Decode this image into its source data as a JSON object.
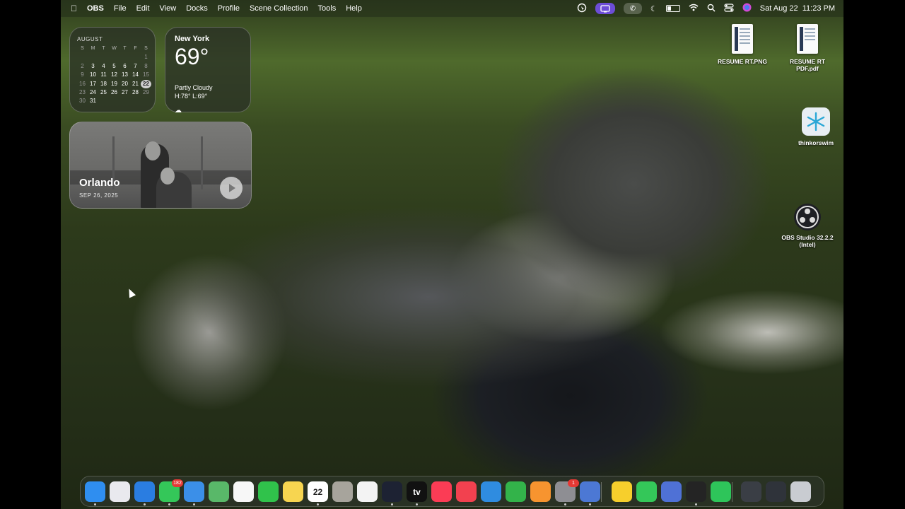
{
  "menubar": {
    "app_name": "OBS",
    "menus": [
      "File",
      "Edit",
      "View",
      "Docks",
      "Profile",
      "Scene Collection",
      "Tools",
      "Help"
    ],
    "status_icons": [
      "cursor-circle-icon",
      "screen-record-icon",
      "phone-icon",
      "moon-icon",
      "battery-icon",
      "wifi-icon",
      "search-icon",
      "control-center-icon",
      "siri-icon"
    ],
    "datetime": "Sat Aug 22  11:23 PM"
  },
  "calendar": {
    "month": "AUGUST",
    "weekdays": [
      "S",
      "M",
      "T",
      "W",
      "T",
      "F",
      "S"
    ],
    "leading_blanks": 6,
    "days": [
      "1",
      "2",
      "3",
      "4",
      "5",
      "6",
      "7",
      "8",
      "9",
      "10",
      "11",
      "12",
      "13",
      "14",
      "15",
      "16",
      "17",
      "18",
      "19",
      "20",
      "21",
      "22",
      "23",
      "24",
      "25",
      "26",
      "27",
      "28",
      "29",
      "30",
      "31"
    ],
    "today": "22"
  },
  "weather": {
    "city": "New York",
    "temperature": "69°",
    "condition": "Partly Cloudy",
    "high_low": "H:78° L:69°"
  },
  "photo": {
    "title": "Orlando",
    "date": "SEP 26, 2025"
  },
  "desktop_icons": [
    {
      "label": "RESUME RT.PNG",
      "kind": "image-file"
    },
    {
      "label": "RESUME RT PDF.pdf",
      "kind": "pdf-file"
    },
    {
      "label": "thinkorswim",
      "kind": "app-alias"
    },
    {
      "label": "OBS Studio 32.2.2 (Intel)",
      "kind": "app"
    }
  ],
  "dock": {
    "apps": [
      {
        "name": "finder-icon",
        "color": "#2f8ef0"
      },
      {
        "name": "launchpad-icon",
        "color": "#e9e9ee"
      },
      {
        "name": "safari-icon",
        "color": "#2a7de1"
      },
      {
        "name": "messages-icon",
        "color": "#34c759",
        "badge": "182"
      },
      {
        "name": "mail-icon",
        "color": "#3b8fe8"
      },
      {
        "name": "maps-icon",
        "color": "#59b869"
      },
      {
        "name": "photos-icon",
        "color": "#f7f7f7"
      },
      {
        "name": "facetime-icon",
        "color": "#30c24b"
      },
      {
        "name": "notes-icon",
        "color": "#f7d550"
      },
      {
        "name": "calendar-icon",
        "color": "#ffffff",
        "label": "22"
      },
      {
        "name": "contacts-icon",
        "color": "#a7a49c"
      },
      {
        "name": "reminders-icon",
        "color": "#f3f3f3"
      },
      {
        "name": "freeform-icon",
        "color": "#1d2233"
      },
      {
        "name": "apple-tv-icon",
        "color": "#111111",
        "label": "tv"
      },
      {
        "name": "music-icon",
        "color": "#fb3c55"
      },
      {
        "name": "news-icon",
        "color": "#f2414f"
      },
      {
        "name": "keynote-icon",
        "color": "#2f8ce0"
      },
      {
        "name": "numbers-icon",
        "color": "#33b34a"
      },
      {
        "name": "pages-icon",
        "color": "#f7942f"
      },
      {
        "name": "system-settings-icon",
        "color": "#8e8e93",
        "badge": "1"
      },
      {
        "name": "iphone-mirroring-icon",
        "color": "#4c78d4"
      },
      {
        "name": "tips-icon",
        "color": "#f7cf2c"
      },
      {
        "name": "phone-icon",
        "color": "#34c759"
      },
      {
        "name": "screen-share-icon",
        "color": "#4f71d6"
      },
      {
        "name": "obs-icon",
        "color": "#242424"
      },
      {
        "name": "whatsapp-icon",
        "color": "#2ec55a"
      },
      {
        "name": "downloads-stack-icon",
        "color": "#3a3e45"
      },
      {
        "name": "documents-stack-icon",
        "color": "#2f333a"
      },
      {
        "name": "trash-icon",
        "color": "#c9ccd1"
      }
    ]
  }
}
